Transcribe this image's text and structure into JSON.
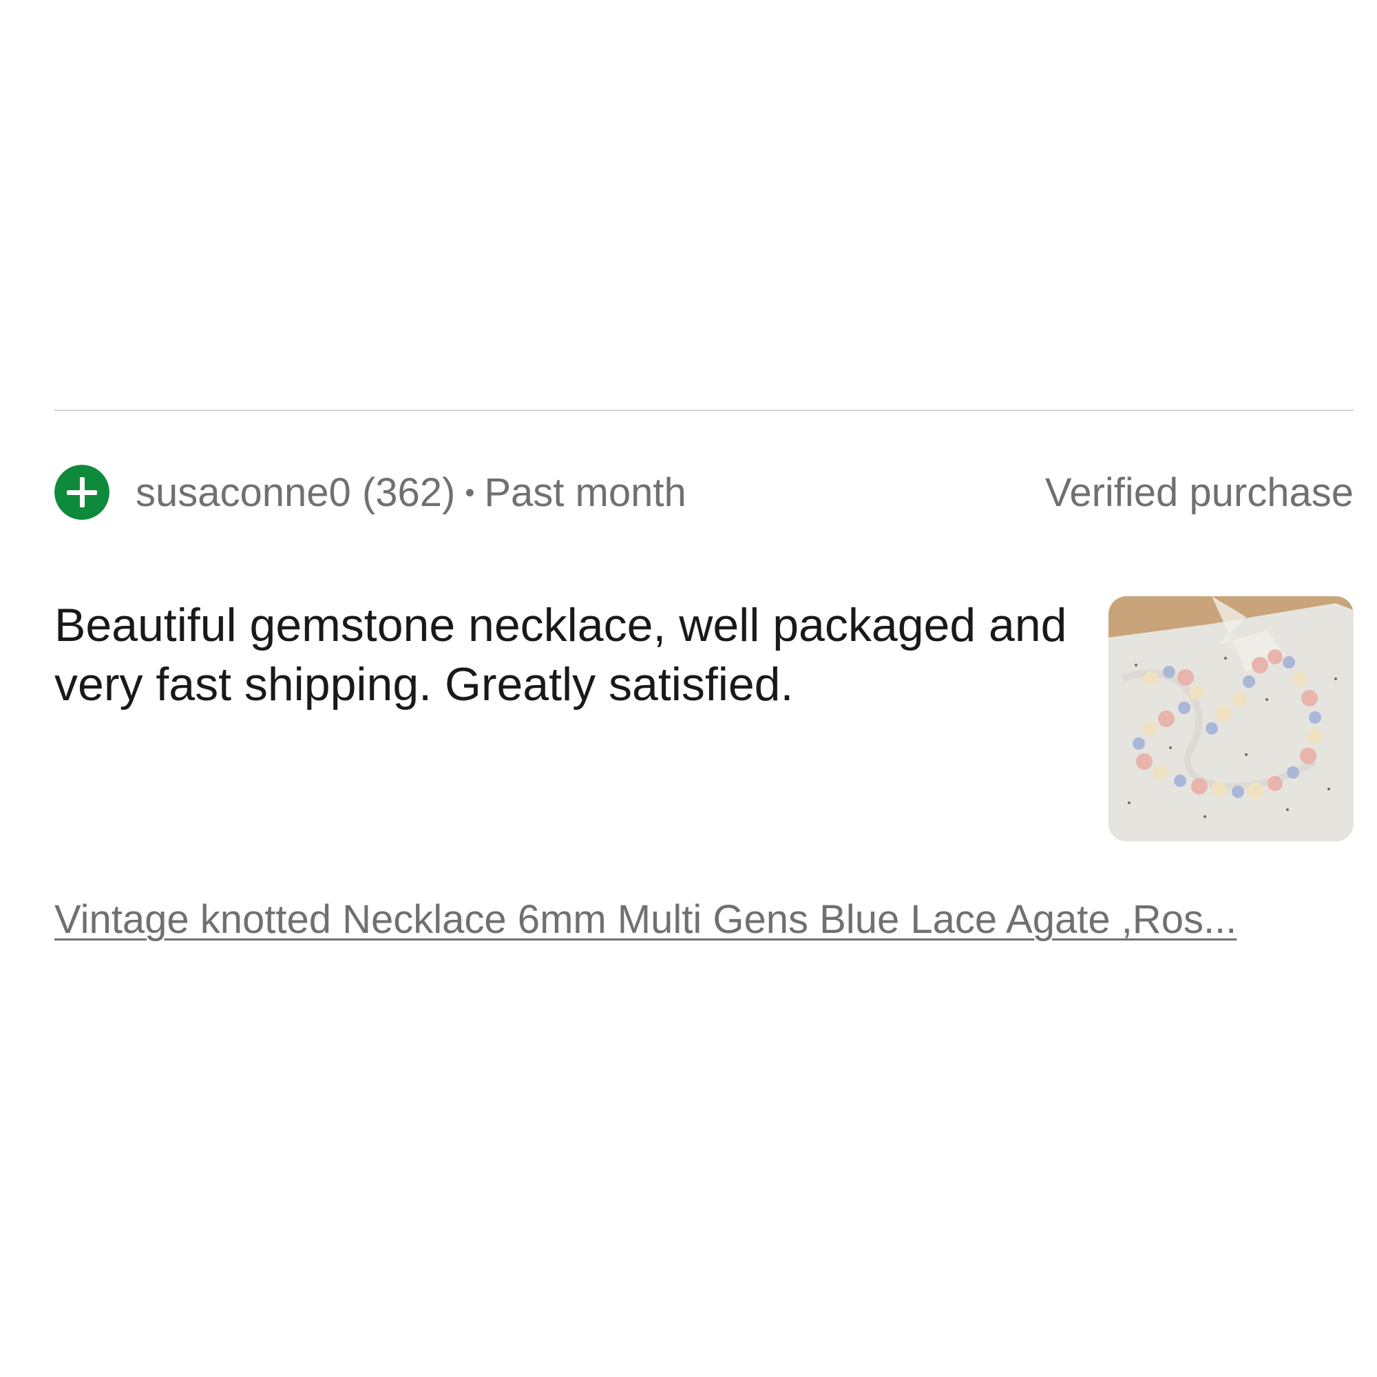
{
  "review": {
    "reviewer": {
      "name": "susaconne0",
      "score": "(362)",
      "separator": "•",
      "time_ago": "Past month",
      "rating_icon": "positive-feedback-plus-icon"
    },
    "verified_label": "Verified purchase",
    "text": "Beautiful gemstone necklace, well packaged and very fast shipping. Greatly satisfied.",
    "photo_icon": "necklace-photo",
    "item_title": "Vintage knotted Necklace 6mm Multi Gens Blue Lace Agate ,Ros..."
  },
  "colors": {
    "positive_green": "#0e8a3c",
    "muted_text": "#707070",
    "body_text": "#191919",
    "divider": "#d2d2d2"
  }
}
